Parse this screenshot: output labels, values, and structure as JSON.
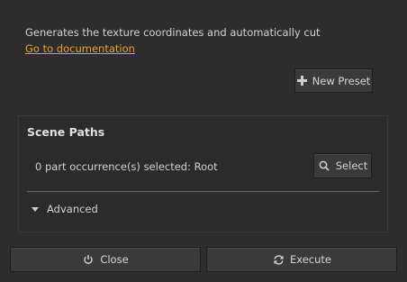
{
  "description": "Generates the texture coordinates and automatically cut",
  "documentation_link": "Go to documentation",
  "new_preset_label": "New Preset",
  "scene_paths": {
    "title": "Scene Paths",
    "selection_text": "0 part occurrence(s) selected: Root",
    "select_label": "Select"
  },
  "advanced_label": "Advanced",
  "footer": {
    "close_label": "Close",
    "execute_label": "Execute"
  },
  "icons": {
    "plus": "plus-icon",
    "search": "search-icon",
    "power": "power-icon",
    "refresh": "refresh-icon",
    "triangle": "triangle-down-icon"
  },
  "colors": {
    "background": "#2d2d2d",
    "link": "#f0a020",
    "button": "#3a3a3a"
  }
}
